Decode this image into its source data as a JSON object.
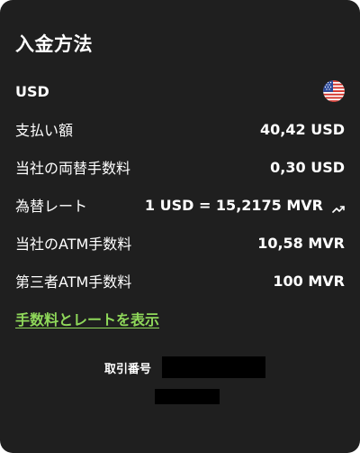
{
  "title": "入金方法",
  "currency": {
    "code": "USD",
    "flag_icon": "us-flag-icon"
  },
  "rows": [
    {
      "label": "支払い額",
      "value": "40,42 USD"
    },
    {
      "label": "当社の両替手数料",
      "value": "0,30 USD"
    },
    {
      "label": "為替レート",
      "value": "1 USD = 15,2175 MVR",
      "icon": "trend-up-icon"
    },
    {
      "label": "当社のATM手数料",
      "value": "10,58 MVR"
    },
    {
      "label": "第三者ATM手数料",
      "value": "100 MVR"
    }
  ],
  "link": {
    "label": "手数料とレートを表示",
    "color": "#8fd85a"
  },
  "transaction": {
    "label": "取引番号"
  },
  "colors": {
    "background": "#1f1f1f",
    "text": "#ffffff",
    "accent": "#8fd85a"
  }
}
